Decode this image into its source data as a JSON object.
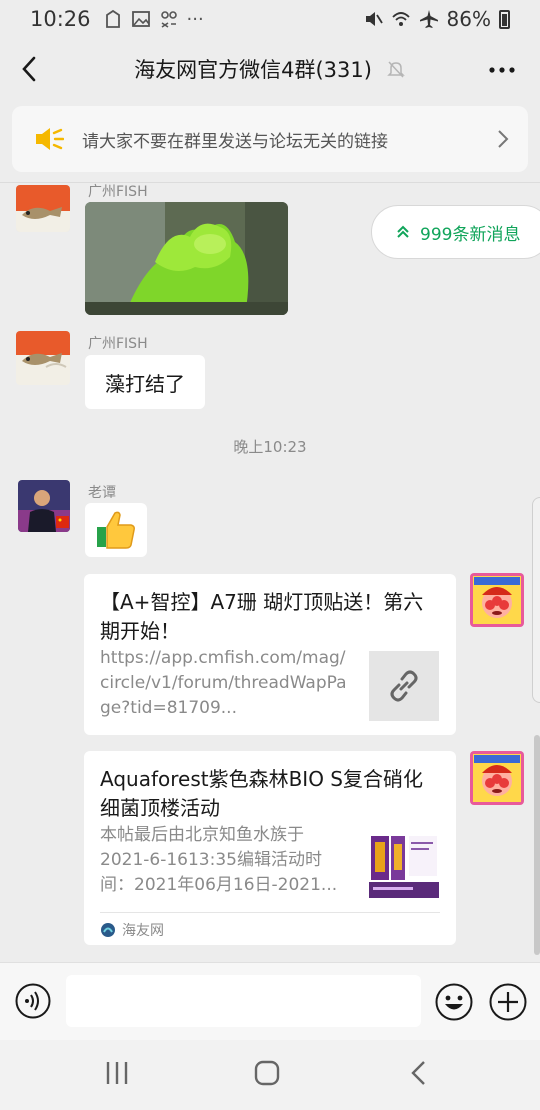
{
  "status_bar": {
    "time": "10:26",
    "indicators": "···",
    "battery": "86%"
  },
  "header": {
    "title": "海友网官方微信4群(331)"
  },
  "notice": {
    "text": "请大家不要在群里发送与论坛无关的链接"
  },
  "new_messages": {
    "label": "999条新消息"
  },
  "messages": [
    {
      "sender": "广州FISH",
      "type": "image"
    },
    {
      "sender": "广州FISH",
      "text": "藻打结了"
    },
    {
      "sender": "老谭",
      "type": "thumbs-up-emoji"
    }
  ],
  "time_separator": "晚上10:23",
  "link_card_1": {
    "title": "【A+智控】A7珊 瑚灯顶贴送！第六期开始！",
    "url": "https://app.cmfish.com/mag/circle/v1/forum/threadWapPage?tid=81709..."
  },
  "link_card_2": {
    "title": "Aquaforest紫色森林BIO S复合硝化细菌顶楼活动",
    "desc": "本帖最后由北京知鱼水族于2021-6-1613:35编辑活动时间：2021年06月16日-2021...",
    "source": "海友网"
  },
  "colors": {
    "accent_green": "#10a45a",
    "background": "#ededed",
    "speaker_yellow": "#f5b800"
  }
}
